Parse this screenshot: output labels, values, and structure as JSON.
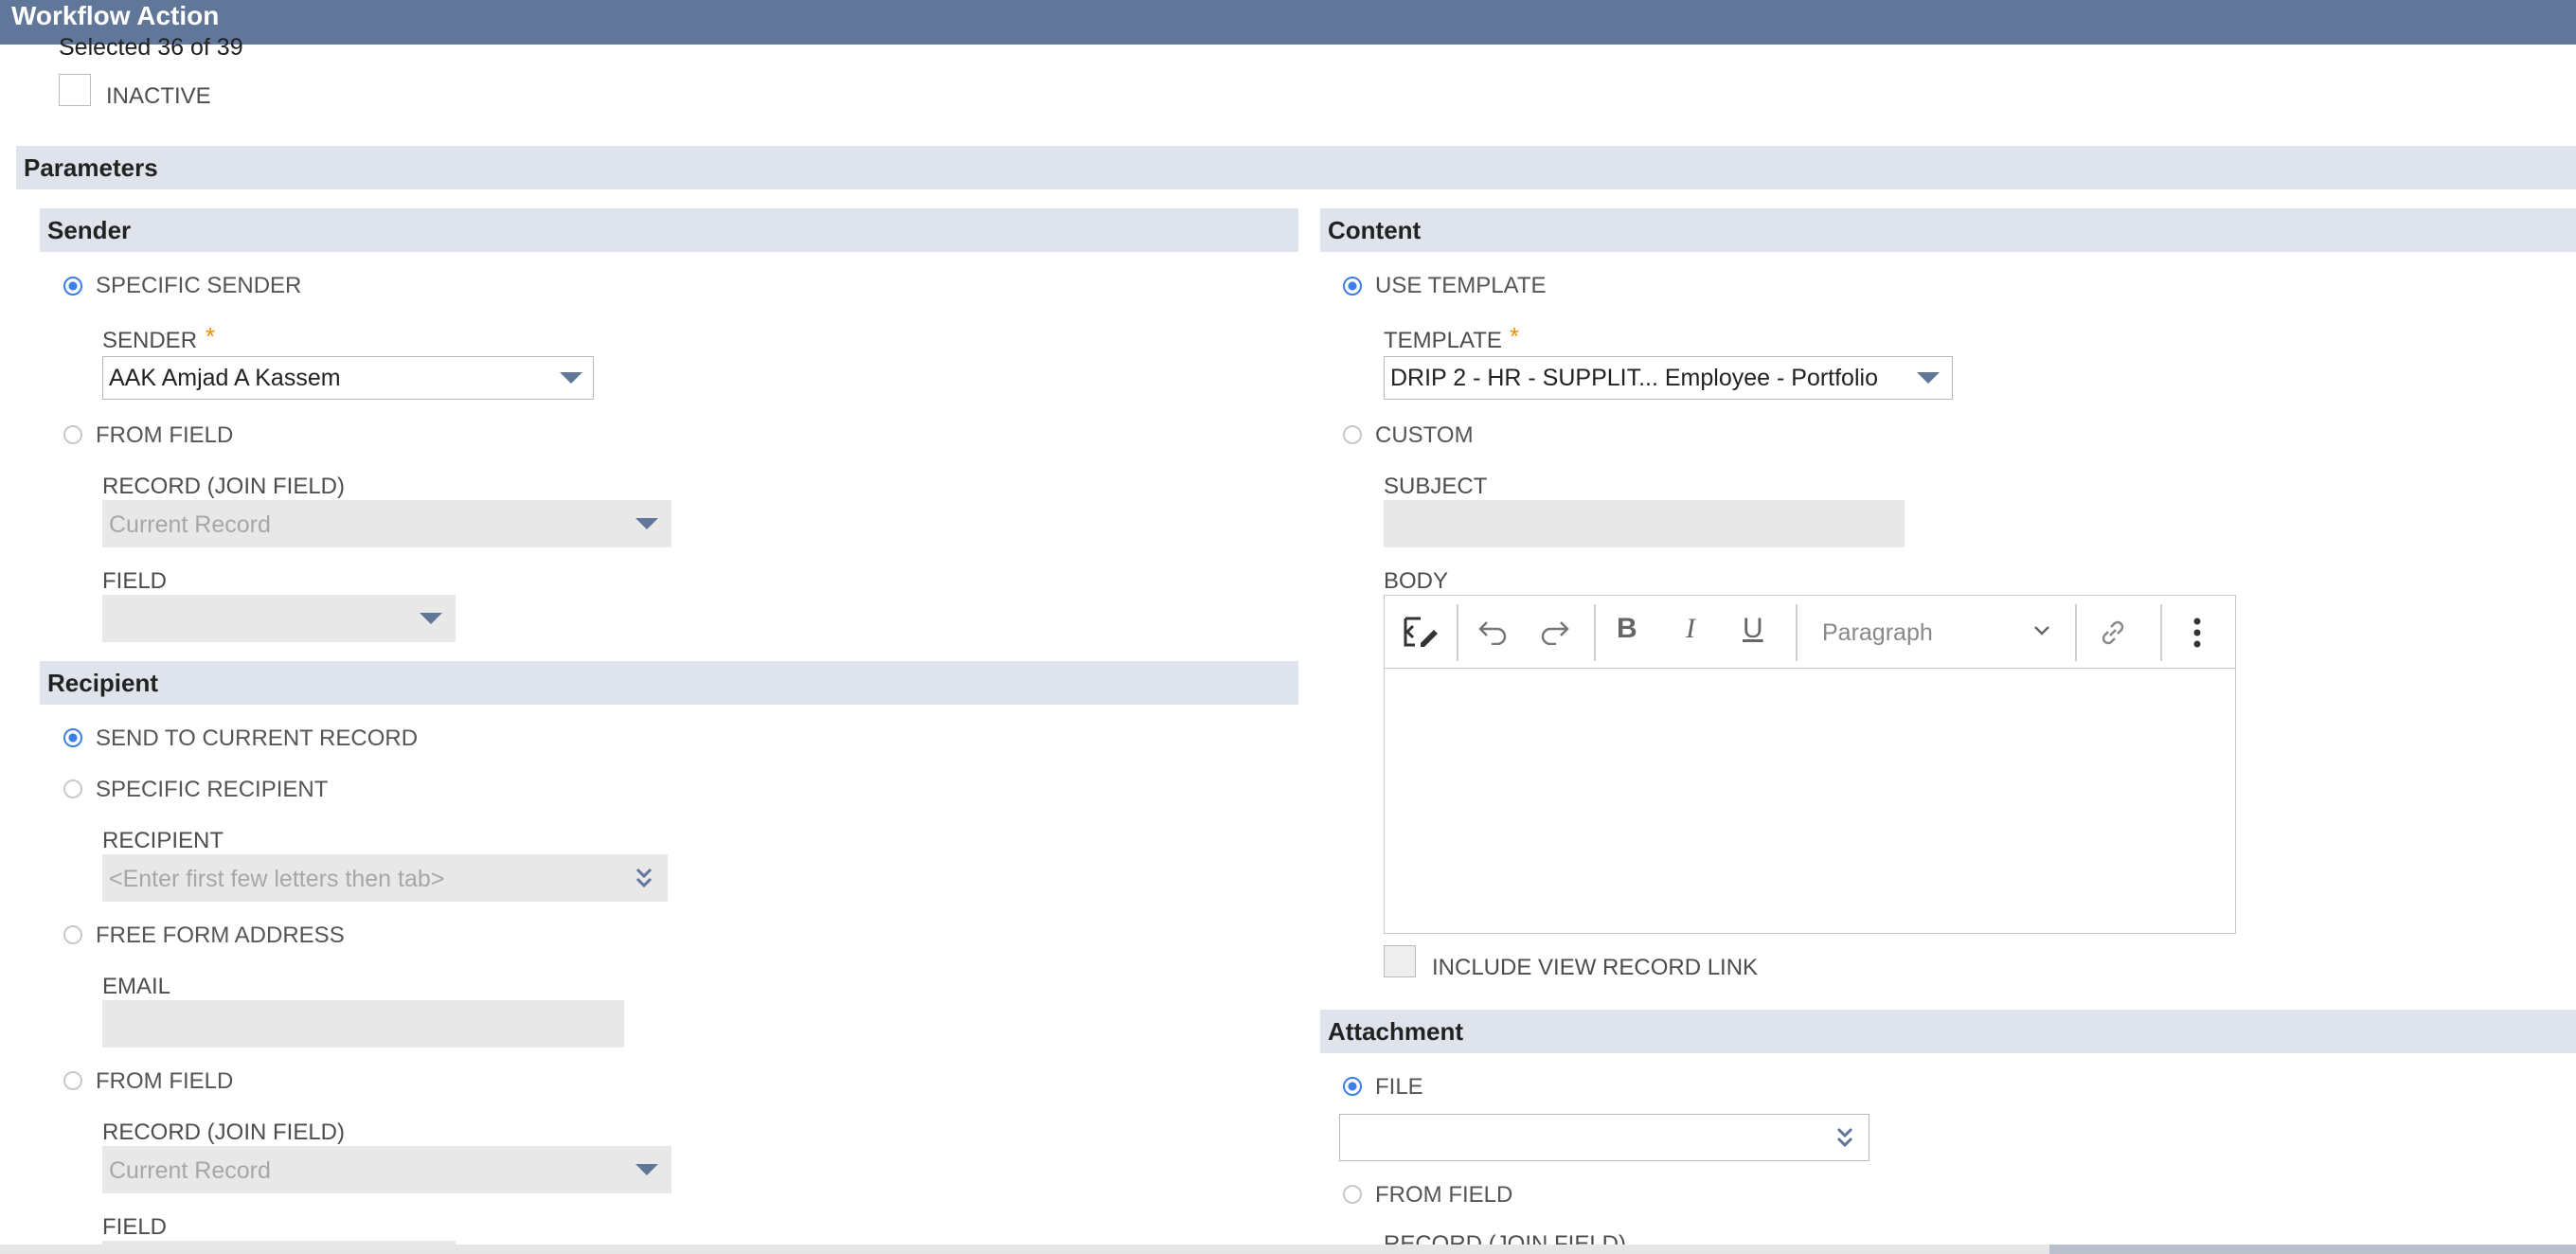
{
  "window": {
    "title": "Workflow Action"
  },
  "selection": {
    "text": "Selected 36 of 39"
  },
  "inactive": {
    "label": "INACTIVE",
    "checked": false
  },
  "parameters": {
    "title": "Parameters"
  },
  "sender": {
    "title": "Sender",
    "specific_sender_label": "SPECIFIC SENDER",
    "sender_label": "SENDER",
    "required_mark": "*",
    "sender_value": "AAK Amjad A Kassem",
    "from_field_label": "FROM FIELD",
    "record_join_label": "RECORD (JOIN FIELD)",
    "record_join_value": "Current Record",
    "field_label": "FIELD",
    "field_value": ""
  },
  "recipient": {
    "title": "Recipient",
    "send_current_label": "SEND TO CURRENT RECORD",
    "specific_recipient_label": "SPECIFIC RECIPIENT",
    "recipient_label": "RECIPIENT",
    "recipient_placeholder": "<Enter first few letters then tab>",
    "free_form_label": "FREE FORM ADDRESS",
    "email_label": "EMAIL",
    "from_field_label": "FROM FIELD",
    "record_join_label": "RECORD (JOIN FIELD)",
    "record_join_value": "Current Record",
    "field_label": "FIELD"
  },
  "content": {
    "title": "Content",
    "use_template_label": "USE TEMPLATE",
    "template_label": "TEMPLATE",
    "required_mark": "*",
    "template_value": "DRIP 2 - HR - SUPPLIT... Employee - Portfolio",
    "custom_label": "CUSTOM",
    "subject_label": "SUBJECT",
    "body_label": "BODY",
    "paragraph_label": "Paragraph",
    "include_link_label": "INCLUDE VIEW RECORD LINK"
  },
  "attachment": {
    "title": "Attachment",
    "file_label": "FILE",
    "from_field_label": "FROM FIELD",
    "record_join_label": "RECORD (JOIN FIELD)"
  },
  "colors": {
    "header": "#607799",
    "section": "#dfe3eb",
    "radio_on": "#3d7ee6",
    "required": "#e8900c"
  }
}
